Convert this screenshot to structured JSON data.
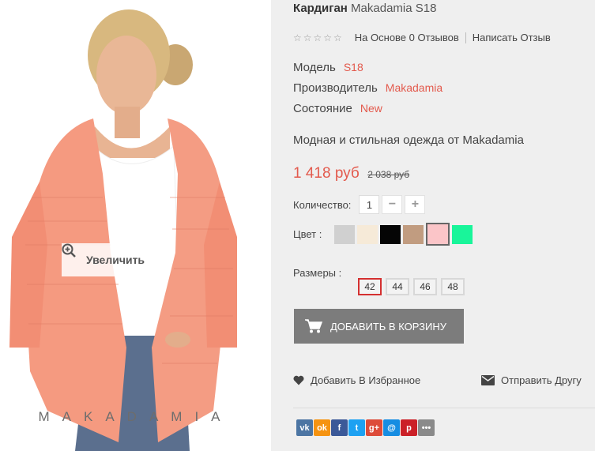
{
  "image": {
    "zoom_label": "Увеличить",
    "watermark": "MAKADAMIA"
  },
  "product": {
    "name": "Кардиган",
    "model_suffix": "Makadamia S18",
    "rating_stars": "☆☆☆☆☆",
    "reviews_text": "На Основе 0 Отзывов",
    "write_review": "Написать Отзыв",
    "model_label": "Модель",
    "model_value": "S18",
    "maker_label": "Производитель",
    "maker_value": "Makadamia",
    "condition_label": "Состояние",
    "condition_value": "New",
    "description": "Модная и стильная одежда от Makadamia",
    "price": "1 418 руб",
    "old_price": "2 038 руб"
  },
  "quantity": {
    "label": "Количество:",
    "value": "1",
    "minus": "−",
    "plus": "+"
  },
  "colors": {
    "label": "Цвет :",
    "swatches": [
      "#d0d0d0",
      "#f6ead8",
      "#050505",
      "#c19c80",
      "#fbc5c8",
      "#19f59a"
    ],
    "selected_index": 4
  },
  "sizes": {
    "label": "Размеры :",
    "options": [
      "42",
      "44",
      "46",
      "48"
    ],
    "selected": "42"
  },
  "actions": {
    "add_to_cart": "ДОБАВИТЬ В КОРЗИНУ",
    "add_to_wishlist": "Добавить В Избранное",
    "send_to_friend": "Отправить Другу"
  },
  "share": [
    {
      "icon": "vk-icon",
      "glyph": "vk",
      "color": "#4c75a3"
    },
    {
      "icon": "odnoklassniki-icon",
      "glyph": "ok",
      "color": "#f59311"
    },
    {
      "icon": "facebook-icon",
      "glyph": "f",
      "color": "#3b5998"
    },
    {
      "icon": "twitter-icon",
      "glyph": "t",
      "color": "#1da1f2"
    },
    {
      "icon": "google-plus-icon",
      "glyph": "g+",
      "color": "#dd4b39"
    },
    {
      "icon": "mail-icon",
      "glyph": "@",
      "color": "#168de2"
    },
    {
      "icon": "pinterest-icon",
      "glyph": "p",
      "color": "#cb2027"
    },
    {
      "icon": "more-icon",
      "glyph": "•••",
      "color": "#8a8a8a"
    }
  ]
}
